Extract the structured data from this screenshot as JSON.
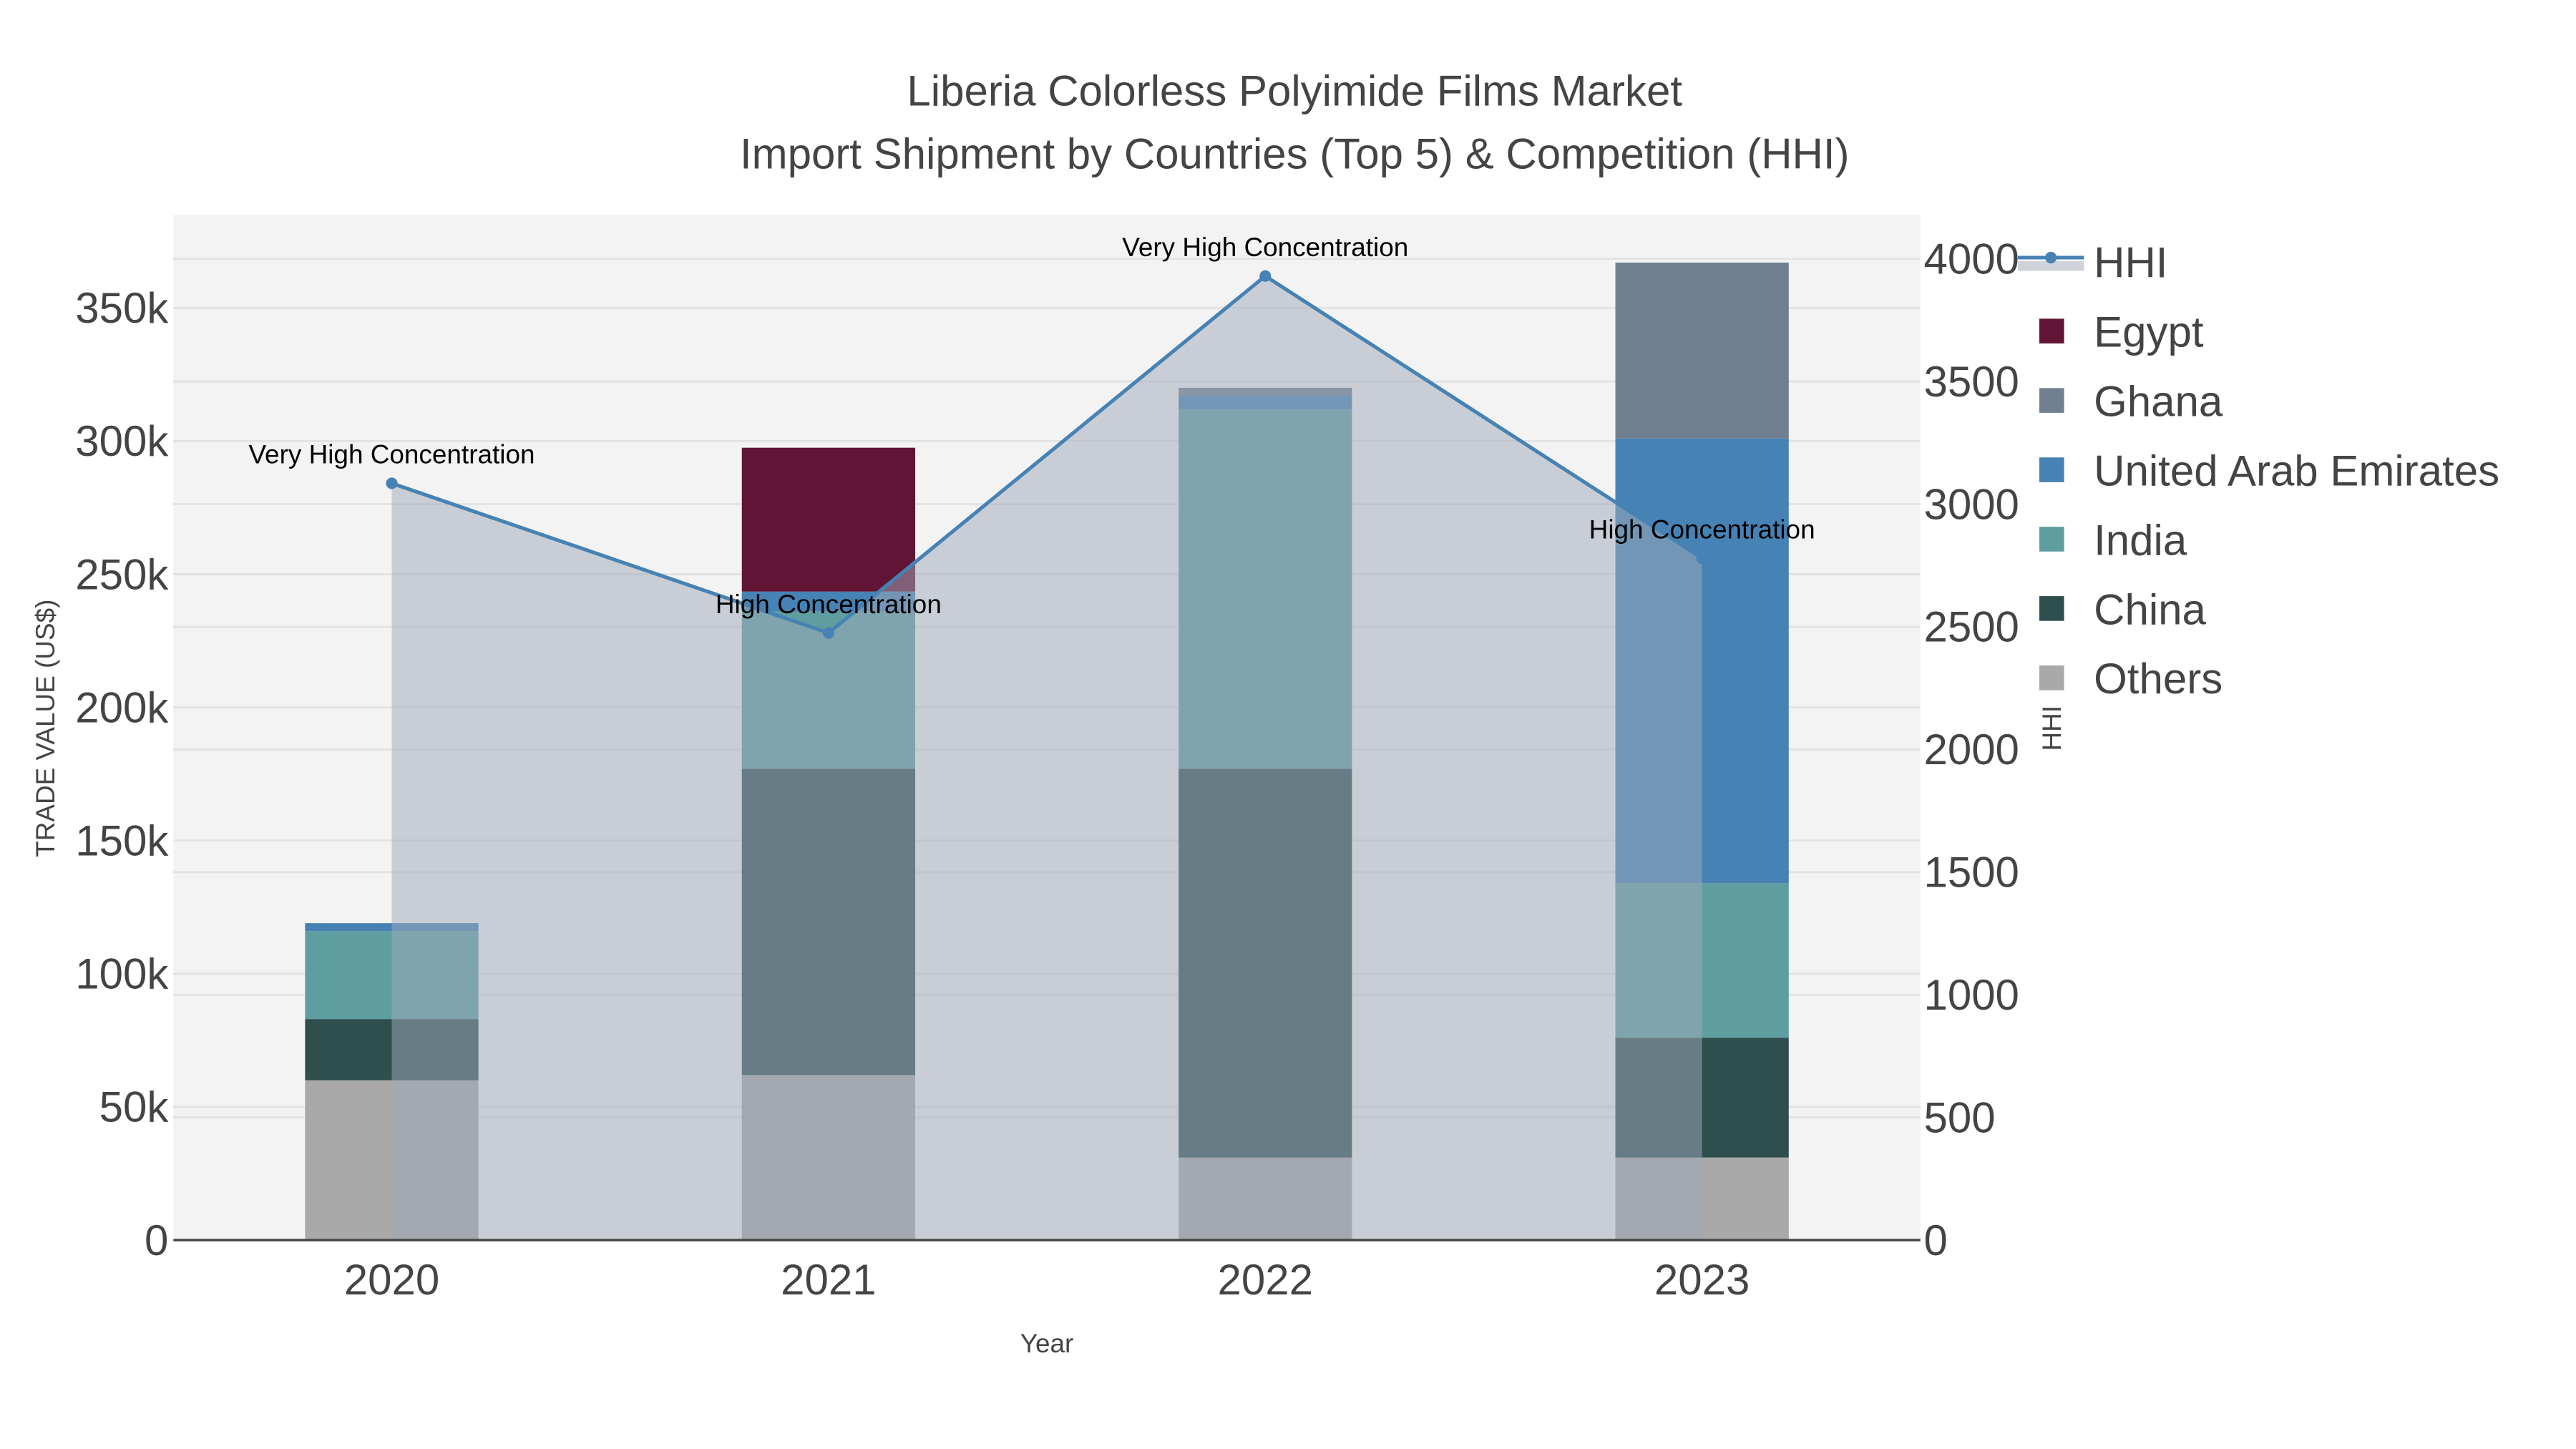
{
  "chart_data": {
    "type": "bar",
    "title": "Liberia Colorless Polyimide Films Market",
    "subtitle": "Import Shipment by Countries (Top 5) & Competition (HHI)",
    "xlabel": "Year",
    "ylabel": "TRADE VALUE (US$)",
    "y2label": "HHI",
    "categories": [
      "2020",
      "2021",
      "2022",
      "2023"
    ],
    "ylim": [
      0,
      385000
    ],
    "y2lim": [
      0,
      4180
    ],
    "yticks": [
      0,
      50000,
      100000,
      150000,
      200000,
      250000,
      300000,
      350000
    ],
    "ytick_labels": [
      "0",
      "50k",
      "100k",
      "150k",
      "200k",
      "250k",
      "300k",
      "350k"
    ],
    "y2ticks": [
      0,
      500,
      1000,
      1500,
      2000,
      2500,
      3000,
      3500,
      4000
    ],
    "y2tick_labels": [
      "0",
      "500",
      "1000",
      "1500",
      "2000",
      "2500",
      "3000",
      "3500",
      "4000"
    ],
    "stacked": true,
    "series": [
      {
        "name": "Others",
        "color": "#a9a9a9",
        "values": [
          60000,
          62000,
          31000,
          31000
        ]
      },
      {
        "name": "China",
        "color": "#2f4f4f",
        "values": [
          23000,
          115000,
          146000,
          45000
        ]
      },
      {
        "name": "India",
        "color": "#5f9ea0",
        "values": [
          33000,
          59000,
          135000,
          58000
        ]
      },
      {
        "name": "United Arab Emirates",
        "color": "#4682b4",
        "values": [
          3000,
          7500,
          5000,
          167000
        ]
      },
      {
        "name": "Ghana",
        "color": "#708090",
        "values": [
          0,
          0,
          3000,
          66000
        ]
      },
      {
        "name": "Egypt",
        "color": "#611434",
        "values": [
          0,
          54000,
          0,
          0
        ]
      }
    ],
    "hhi": {
      "name": "HHI",
      "color": "#4682b4",
      "values": [
        3085,
        2475,
        3930,
        2780
      ],
      "annotations": [
        "Very High Concentration",
        "High Concentration",
        "Very High Concentration",
        "High Concentration"
      ]
    },
    "legend_order": [
      "HHI",
      "Egypt",
      "Ghana",
      "United Arab Emirates",
      "India",
      "China",
      "Others"
    ],
    "legend_position": "right",
    "grid": true
  }
}
